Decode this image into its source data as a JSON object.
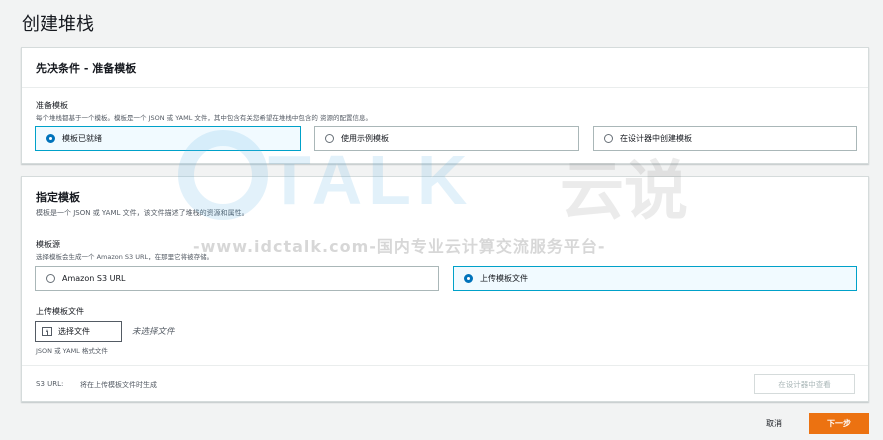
{
  "page": {
    "title": "创建堆栈"
  },
  "prerequisite": {
    "header": "先决条件 - 准备模板",
    "label": "准备模板",
    "description": "每个堆栈都基于一个模板。模板是一个 JSON 或 YAML 文件，其中包含有关您希望在堆栈中包含的        资源的配置信息。",
    "options": [
      {
        "label": "模板已就绪",
        "selected": true
      },
      {
        "label": "使用示例模板",
        "selected": false
      },
      {
        "label": "在设计器中创建模板",
        "selected": false
      }
    ]
  },
  "specify": {
    "header": "指定模板",
    "description": "模板是一个 JSON 或 YAML 文件，该文件描述了堆栈的资源和属性。",
    "source_label": "模板源",
    "source_description": "选择模板会生成一个 Amazon S3 URL，在那里它将被存储。",
    "source_options": [
      {
        "label": "Amazon S3 URL",
        "selected": false
      },
      {
        "label": "上传模板文件",
        "selected": true
      }
    ],
    "upload_label": "上传模板文件",
    "choose_file_label": "选择文件",
    "no_file_text": "未选择文件",
    "formats_text": "JSON 或 YAML 格式文件",
    "s3_url_label": "S3 URL:",
    "s3_url_value": "将在上传模板文件时生成",
    "view_designer_label": "在设计器中查看"
  },
  "actions": {
    "cancel_label": "取消",
    "next_label": "下一步"
  },
  "watermark": {
    "brand": "TALK",
    "brand_cn": "云说",
    "url": "-www.idctalk.com-国内专业云计算交流服务平台-"
  },
  "colors": {
    "accent": "#0073bb",
    "primary_button": "#ec7211",
    "selected_border": "#00a1c9"
  }
}
